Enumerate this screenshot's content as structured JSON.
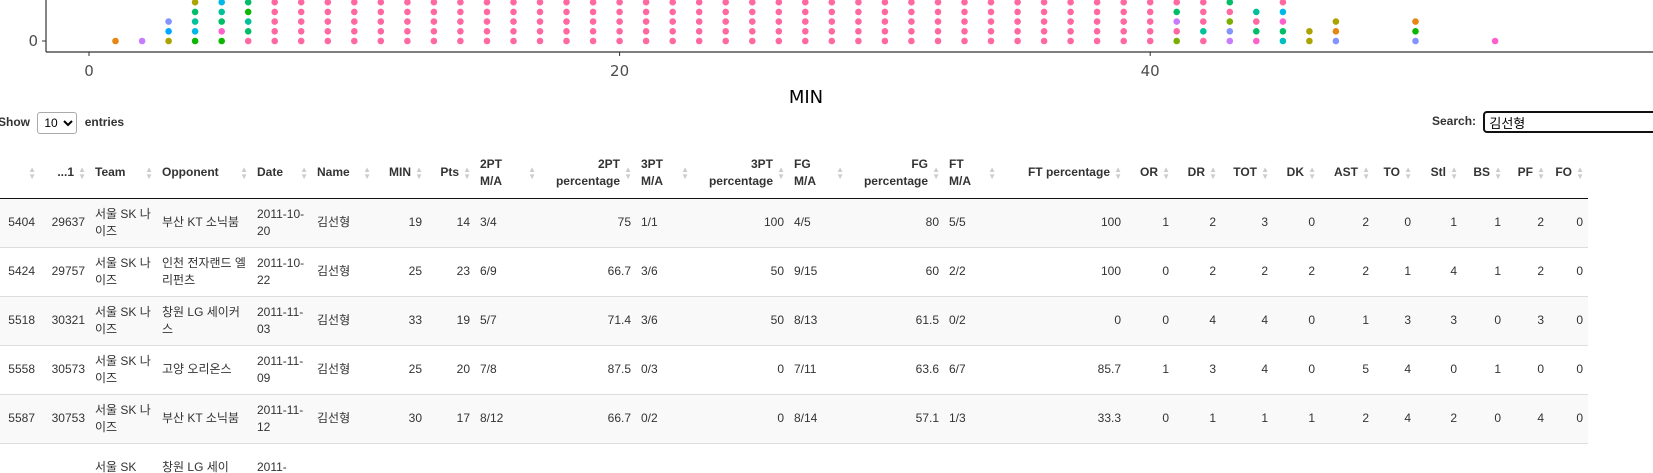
{
  "chart_data": {
    "type": "scatter",
    "xlabel": "MIN",
    "ylabel": "",
    "xlim": [
      -1.6,
      55
    ],
    "ylim": [
      -0.4,
      3.3
    ],
    "x_ticks": [
      0,
      20,
      40
    ],
    "y_ticks": [
      0
    ],
    "grid": false,
    "point_colors": [
      "#f8766d",
      "#e68613",
      "#cd9600",
      "#aba300",
      "#7cae00",
      "#0cb702",
      "#00be67",
      "#00c19a",
      "#00bfc4",
      "#00b8e7",
      "#00a9ff",
      "#8494ff",
      "#c77cff",
      "#ed68ed",
      "#ff61cc",
      "#ff68a1"
    ],
    "columns": [
      {
        "x": 1,
        "colors": [
          "#e68613"
        ]
      },
      {
        "x": 2,
        "colors": [
          "#c77cff"
        ]
      },
      {
        "x": 3,
        "colors": [
          "#aba300",
          "#00a9ff",
          "#8494ff"
        ]
      },
      {
        "x": 4,
        "colors": [
          "#0cb702",
          "#00b8e7",
          "#00c19a",
          "#00be67",
          "#aba300"
        ]
      },
      {
        "x": 5,
        "colors": [
          "#0cb702",
          "#ff61cc",
          "#00be67",
          "#00c19a",
          "#00b8e7",
          "#0cb702",
          "#00be67"
        ]
      },
      {
        "x": 6,
        "colors": [
          "#ff68a1",
          "#00be67",
          "#00c19a",
          "#0cb702",
          "#00be67",
          "#0cb702",
          "#00be67"
        ]
      },
      {
        "x": 7,
        "colors": [
          "#ff68a1",
          "#ff68a1",
          "#ff68a1",
          "#ff68a1",
          "#ff68a1",
          "#ff68a1",
          "#00be67"
        ]
      },
      {
        "x": 8,
        "colors": [
          "#ff68a1",
          "#ff68a1",
          "#ff68a1",
          "#ff68a1",
          "#ff68a1",
          "#ff68a1",
          "#00a9ff"
        ]
      },
      {
        "x": 9,
        "colors": [
          "#ff68a1",
          "#ff68a1",
          "#ff68a1",
          "#ff68a1",
          "#ff68a1",
          "#ff68a1",
          "#ff68a1"
        ]
      },
      {
        "x": 10,
        "colors": [
          "#ff68a1",
          "#ff68a1",
          "#ff68a1",
          "#ff68a1",
          "#ff68a1",
          "#ff68a1",
          "#ff68a1"
        ]
      },
      {
        "x": 11,
        "colors": [
          "#ff68a1",
          "#ff68a1",
          "#ff68a1",
          "#ff68a1",
          "#ff68a1",
          "#ff68a1",
          "#ff68a1"
        ]
      },
      {
        "x": 12,
        "colors": [
          "#ff68a1",
          "#ff68a1",
          "#ff68a1",
          "#ff68a1",
          "#ff68a1",
          "#ff68a1",
          "#ff68a1"
        ]
      },
      {
        "x": 13,
        "colors": [
          "#ff68a1",
          "#ff68a1",
          "#ff68a1",
          "#ff68a1",
          "#ff68a1",
          "#ff68a1",
          "#ff68a1"
        ]
      },
      {
        "x": 14,
        "colors": [
          "#ff68a1",
          "#ff68a1",
          "#ff68a1",
          "#ff68a1",
          "#ff68a1",
          "#ff68a1",
          "#ff68a1"
        ]
      },
      {
        "x": 15,
        "colors": [
          "#ff68a1",
          "#ff68a1",
          "#ff68a1",
          "#ff68a1",
          "#ff68a1",
          "#ff68a1",
          "#ff68a1"
        ]
      },
      {
        "x": 16,
        "colors": [
          "#ff68a1",
          "#ff68a1",
          "#ff68a1",
          "#ff68a1",
          "#ff68a1",
          "#ff68a1",
          "#ff68a1"
        ]
      },
      {
        "x": 17,
        "colors": [
          "#ff68a1",
          "#ff68a1",
          "#ff68a1",
          "#ff68a1",
          "#ff68a1",
          "#ff68a1",
          "#ff68a1"
        ]
      },
      {
        "x": 18,
        "colors": [
          "#ff68a1",
          "#ff68a1",
          "#ff68a1",
          "#ff68a1",
          "#ff68a1",
          "#ff68a1",
          "#ff68a1"
        ]
      },
      {
        "x": 19,
        "colors": [
          "#ff68a1",
          "#ff68a1",
          "#ff68a1",
          "#ff68a1",
          "#ff68a1",
          "#ff68a1",
          "#ff68a1"
        ]
      },
      {
        "x": 20,
        "colors": [
          "#ff68a1",
          "#ff68a1",
          "#ff68a1",
          "#ff68a1",
          "#ff68a1",
          "#ff68a1",
          "#ff68a1"
        ]
      },
      {
        "x": 21,
        "colors": [
          "#ff68a1",
          "#ff68a1",
          "#ff68a1",
          "#ff68a1",
          "#ff68a1",
          "#ff68a1",
          "#ff68a1"
        ]
      },
      {
        "x": 22,
        "colors": [
          "#ff68a1",
          "#ff68a1",
          "#ff68a1",
          "#ff68a1",
          "#ff68a1",
          "#ff68a1",
          "#ff68a1"
        ]
      },
      {
        "x": 23,
        "colors": [
          "#ff68a1",
          "#ff68a1",
          "#ff68a1",
          "#ff68a1",
          "#ff68a1",
          "#ff68a1",
          "#ff68a1"
        ]
      },
      {
        "x": 24,
        "colors": [
          "#ff68a1",
          "#ff68a1",
          "#ff68a1",
          "#ff68a1",
          "#ff68a1",
          "#ff68a1",
          "#ff68a1"
        ]
      },
      {
        "x": 25,
        "colors": [
          "#ff68a1",
          "#ff68a1",
          "#ff68a1",
          "#ff68a1",
          "#ff68a1",
          "#ff68a1",
          "#ff68a1"
        ]
      },
      {
        "x": 26,
        "colors": [
          "#ff68a1",
          "#ff68a1",
          "#ff68a1",
          "#ff68a1",
          "#ff68a1",
          "#ff68a1",
          "#ff68a1"
        ]
      },
      {
        "x": 27,
        "colors": [
          "#ff68a1",
          "#ff68a1",
          "#ff68a1",
          "#ff68a1",
          "#ff68a1",
          "#ff68a1",
          "#ff68a1"
        ]
      },
      {
        "x": 28,
        "colors": [
          "#ff68a1",
          "#ff68a1",
          "#ff68a1",
          "#ff68a1",
          "#ff68a1",
          "#ff68a1",
          "#ff68a1"
        ]
      },
      {
        "x": 29,
        "colors": [
          "#ff68a1",
          "#ff68a1",
          "#ff68a1",
          "#ff68a1",
          "#ff68a1",
          "#ff68a1",
          "#ff68a1"
        ]
      },
      {
        "x": 30,
        "colors": [
          "#ff68a1",
          "#ff68a1",
          "#ff68a1",
          "#ff68a1",
          "#ff68a1",
          "#ff68a1",
          "#ff68a1"
        ]
      },
      {
        "x": 31,
        "colors": [
          "#ff68a1",
          "#ff68a1",
          "#ff68a1",
          "#ff68a1",
          "#ff68a1",
          "#ff68a1",
          "#ff68a1"
        ]
      },
      {
        "x": 32,
        "colors": [
          "#ff68a1",
          "#ff68a1",
          "#ff68a1",
          "#ff68a1",
          "#ff68a1",
          "#ff68a1",
          "#ff68a1"
        ]
      },
      {
        "x": 33,
        "colors": [
          "#ff68a1",
          "#ff68a1",
          "#ff68a1",
          "#ff68a1",
          "#ff68a1",
          "#ff68a1",
          "#ff68a1"
        ]
      },
      {
        "x": 34,
        "colors": [
          "#ff68a1",
          "#ff68a1",
          "#ff68a1",
          "#ff68a1",
          "#ff68a1",
          "#ff68a1",
          "#ff68a1"
        ]
      },
      {
        "x": 35,
        "colors": [
          "#ff68a1",
          "#ff68a1",
          "#ff68a1",
          "#ff68a1",
          "#ff68a1",
          "#ff68a1",
          "#ff68a1"
        ]
      },
      {
        "x": 36,
        "colors": [
          "#ff68a1",
          "#ff68a1",
          "#ff68a1",
          "#ff68a1",
          "#ff68a1",
          "#ff68a1",
          "#ff68a1"
        ]
      },
      {
        "x": 37,
        "colors": [
          "#ff68a1",
          "#ff68a1",
          "#ff68a1",
          "#ff68a1",
          "#ff68a1",
          "#ff68a1",
          "#ff68a1"
        ]
      },
      {
        "x": 38,
        "colors": [
          "#ff68a1",
          "#ff68a1",
          "#ff68a1",
          "#ff68a1",
          "#ff68a1",
          "#ff68a1",
          "#ff68a1"
        ]
      },
      {
        "x": 39,
        "colors": [
          "#ff68a1",
          "#ff68a1",
          "#ff68a1",
          "#ff68a1",
          "#ff68a1",
          "#ff68a1",
          "#ff68a1"
        ]
      },
      {
        "x": 40,
        "colors": [
          "#ff68a1",
          "#ff68a1",
          "#ff68a1",
          "#ff68a1",
          "#ff68a1",
          "#ff68a1",
          "#ff68a1"
        ]
      },
      {
        "x": 41,
        "colors": [
          "#7cae00",
          "#ff68a1",
          "#c77cff",
          "#00be67",
          "#ff68a1",
          "#ff68a1",
          "#ff68a1"
        ]
      },
      {
        "x": 42,
        "colors": [
          "#ff68a1",
          "#00c19a",
          "#ff68a1",
          "#ff68a1",
          "#ff68a1",
          "#ff68a1",
          "#ff68a1"
        ]
      },
      {
        "x": 43,
        "colors": [
          "#c77cff",
          "#8494ff",
          "#7cae00",
          "#ff68a1",
          "#00be67",
          "#00b8e7",
          "#ff68a1"
        ]
      },
      {
        "x": 44,
        "colors": [
          "#ff61cc",
          "#00be67",
          "#ff68a1",
          "#00c19a"
        ]
      },
      {
        "x": 45,
        "colors": [
          "#00bfc4",
          "#00be67",
          "#ff61cc",
          "#00b8e7",
          "#ff68a1",
          "#00a9ff",
          "#ff68a1"
        ]
      },
      {
        "x": 46,
        "colors": [
          "#aba300",
          "#aba300"
        ]
      },
      {
        "x": 47,
        "colors": [
          "#8494ff",
          "#e68613",
          "#aba300"
        ]
      },
      {
        "x": 50,
        "colors": [
          "#8494ff",
          "#0cb702",
          "#e68613"
        ]
      },
      {
        "x": 53,
        "colors": [
          "#ff61cc"
        ]
      }
    ]
  },
  "controls": {
    "show_label": "Show",
    "entries_label": "entries",
    "length_value": "10",
    "length_options": [
      "10"
    ],
    "search_label": "Search:",
    "search_value": "김선형"
  },
  "table": {
    "columns": [
      {
        "label": "",
        "num": true
      },
      {
        "label": "...1",
        "num": true
      },
      {
        "label": "Team",
        "num": false
      },
      {
        "label": "Opponent",
        "num": false
      },
      {
        "label": "Date",
        "num": false
      },
      {
        "label": "Name",
        "num": false
      },
      {
        "label": "MIN",
        "num": true
      },
      {
        "label": "Pts",
        "num": true
      },
      {
        "label": "2PT M/A",
        "num": false
      },
      {
        "label": "2PT percentage",
        "num": true
      },
      {
        "label": "3PT M/A",
        "num": false
      },
      {
        "label": "3PT percentage",
        "num": true
      },
      {
        "label": "FG M/A",
        "num": false
      },
      {
        "label": "FG percentage",
        "num": true
      },
      {
        "label": "FT M/A",
        "num": false
      },
      {
        "label": "FT percentage",
        "num": true
      },
      {
        "label": "OR",
        "num": true
      },
      {
        "label": "DR",
        "num": true
      },
      {
        "label": "TOT",
        "num": true
      },
      {
        "label": "DK",
        "num": true
      },
      {
        "label": "AST",
        "num": true
      },
      {
        "label": "TO",
        "num": true
      },
      {
        "label": "Stl",
        "num": true
      },
      {
        "label": "BS",
        "num": true
      },
      {
        "label": "PF",
        "num": true
      },
      {
        "label": "FO",
        "num": true
      }
    ],
    "rows": [
      [
        "5404",
        "29637",
        "서울 SK 나이즈",
        "부산 KT 소닉붐",
        "2011-10-20",
        "김선형",
        "19",
        "14",
        "3/4",
        "75",
        "1/1",
        "100",
        "4/5",
        "80",
        "5/5",
        "100",
        "1",
        "2",
        "3",
        "0",
        "2",
        "0",
        "1",
        "1",
        "2",
        "0"
      ],
      [
        "5424",
        "29757",
        "서울 SK 나이즈",
        "인천 전자랜드 엘리펀츠",
        "2011-10-22",
        "김선형",
        "25",
        "23",
        "6/9",
        "66.7",
        "3/6",
        "50",
        "9/15",
        "60",
        "2/2",
        "100",
        "0",
        "2",
        "2",
        "2",
        "2",
        "1",
        "4",
        "1",
        "2",
        "0"
      ],
      [
        "5518",
        "30321",
        "서울 SK 나이즈",
        "창원 LG 세이커스",
        "2011-11-03",
        "김선형",
        "33",
        "19",
        "5/7",
        "71.4",
        "3/6",
        "50",
        "8/13",
        "61.5",
        "0/2",
        "0",
        "0",
        "4",
        "4",
        "0",
        "1",
        "3",
        "3",
        "0",
        "3",
        "0"
      ],
      [
        "5558",
        "30573",
        "서울 SK 나이즈",
        "고양 오리온스",
        "2011-11-09",
        "김선형",
        "25",
        "20",
        "7/8",
        "87.5",
        "0/3",
        "0",
        "7/11",
        "63.6",
        "6/7",
        "85.7",
        "1",
        "3",
        "4",
        "0",
        "5",
        "4",
        "0",
        "1",
        "0",
        "0"
      ],
      [
        "5587",
        "30753",
        "서울 SK 나이즈",
        "부산 KT 소닉붐",
        "2011-11-12",
        "김선형",
        "30",
        "17",
        "8/12",
        "66.7",
        "0/2",
        "0",
        "8/14",
        "57.1",
        "1/3",
        "33.3",
        "0",
        "1",
        "1",
        "1",
        "2",
        "4",
        "2",
        "0",
        "4",
        "0"
      ],
      [
        "",
        "",
        "서울 SK",
        "창원 LG 세이",
        "2011-",
        "",
        "",
        "",
        "",
        "",
        "",
        "",
        "",
        "",
        "",
        "",
        "",
        "",
        "",
        "",
        "",
        "",
        "",
        "",
        "",
        ""
      ]
    ]
  }
}
